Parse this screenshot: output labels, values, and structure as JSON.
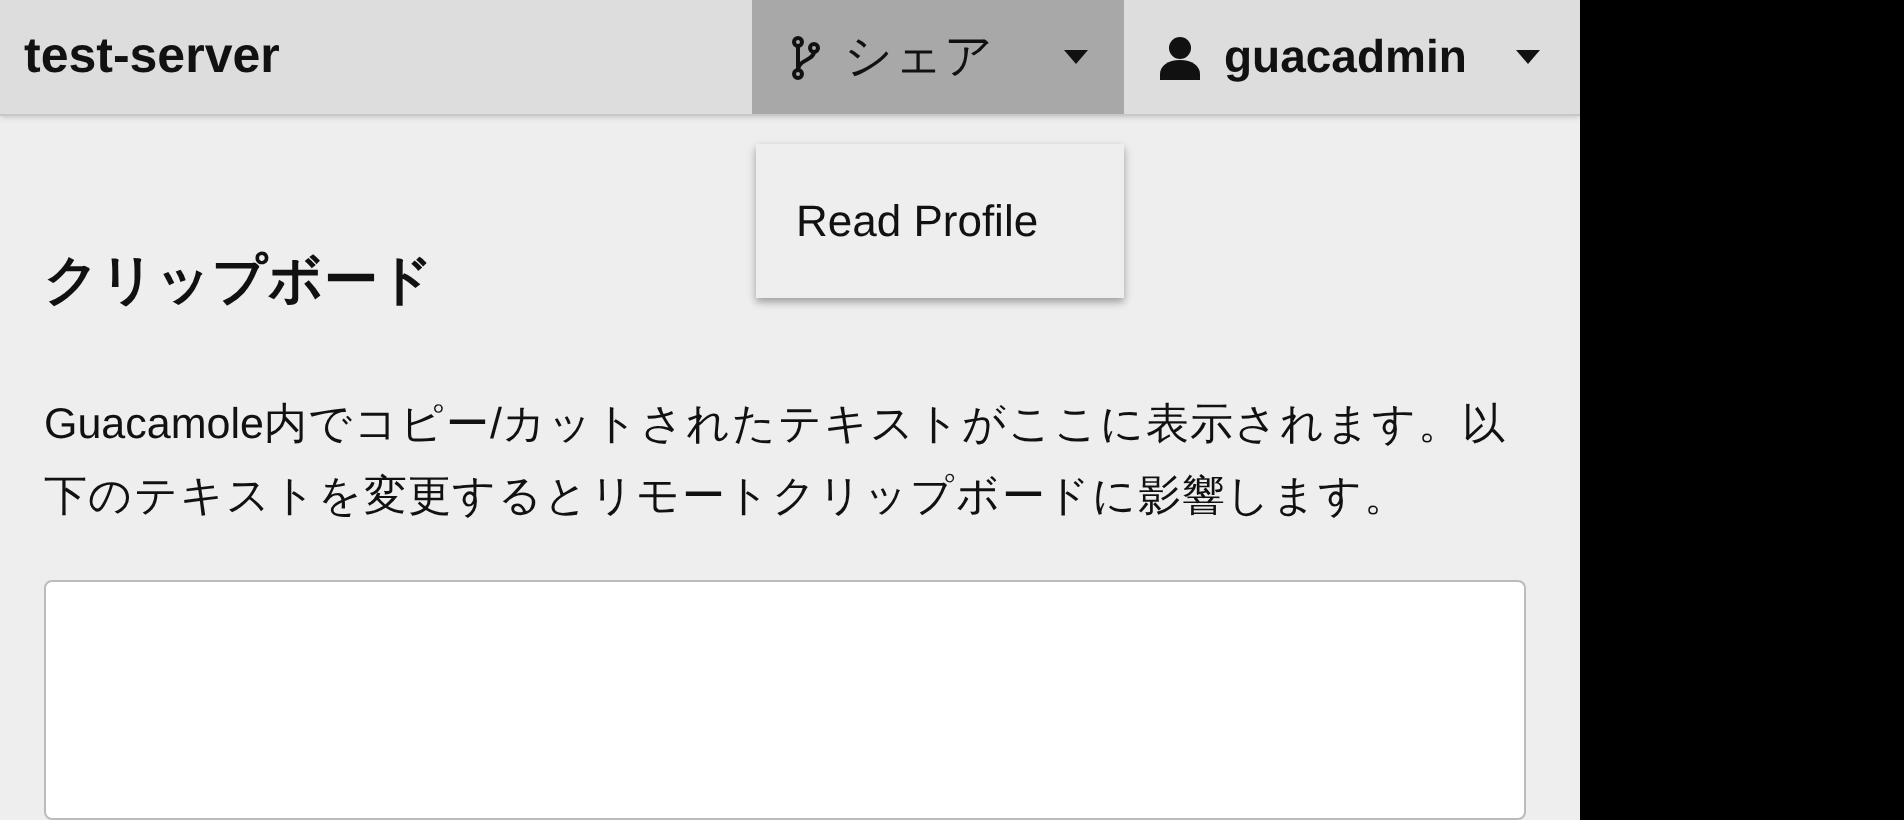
{
  "header": {
    "title": "test-server"
  },
  "share_menu": {
    "label": "シェア",
    "expanded": true,
    "items": [
      {
        "label": "Read Profile"
      }
    ]
  },
  "user_menu": {
    "label": "guacadmin",
    "expanded": false
  },
  "clipboard": {
    "title": "クリップボード",
    "description": "Guacamole内でコピー/カットされたテキストがここに表示されます。以下のテキストを変更するとリモートクリップボードに影響します。"
  }
}
